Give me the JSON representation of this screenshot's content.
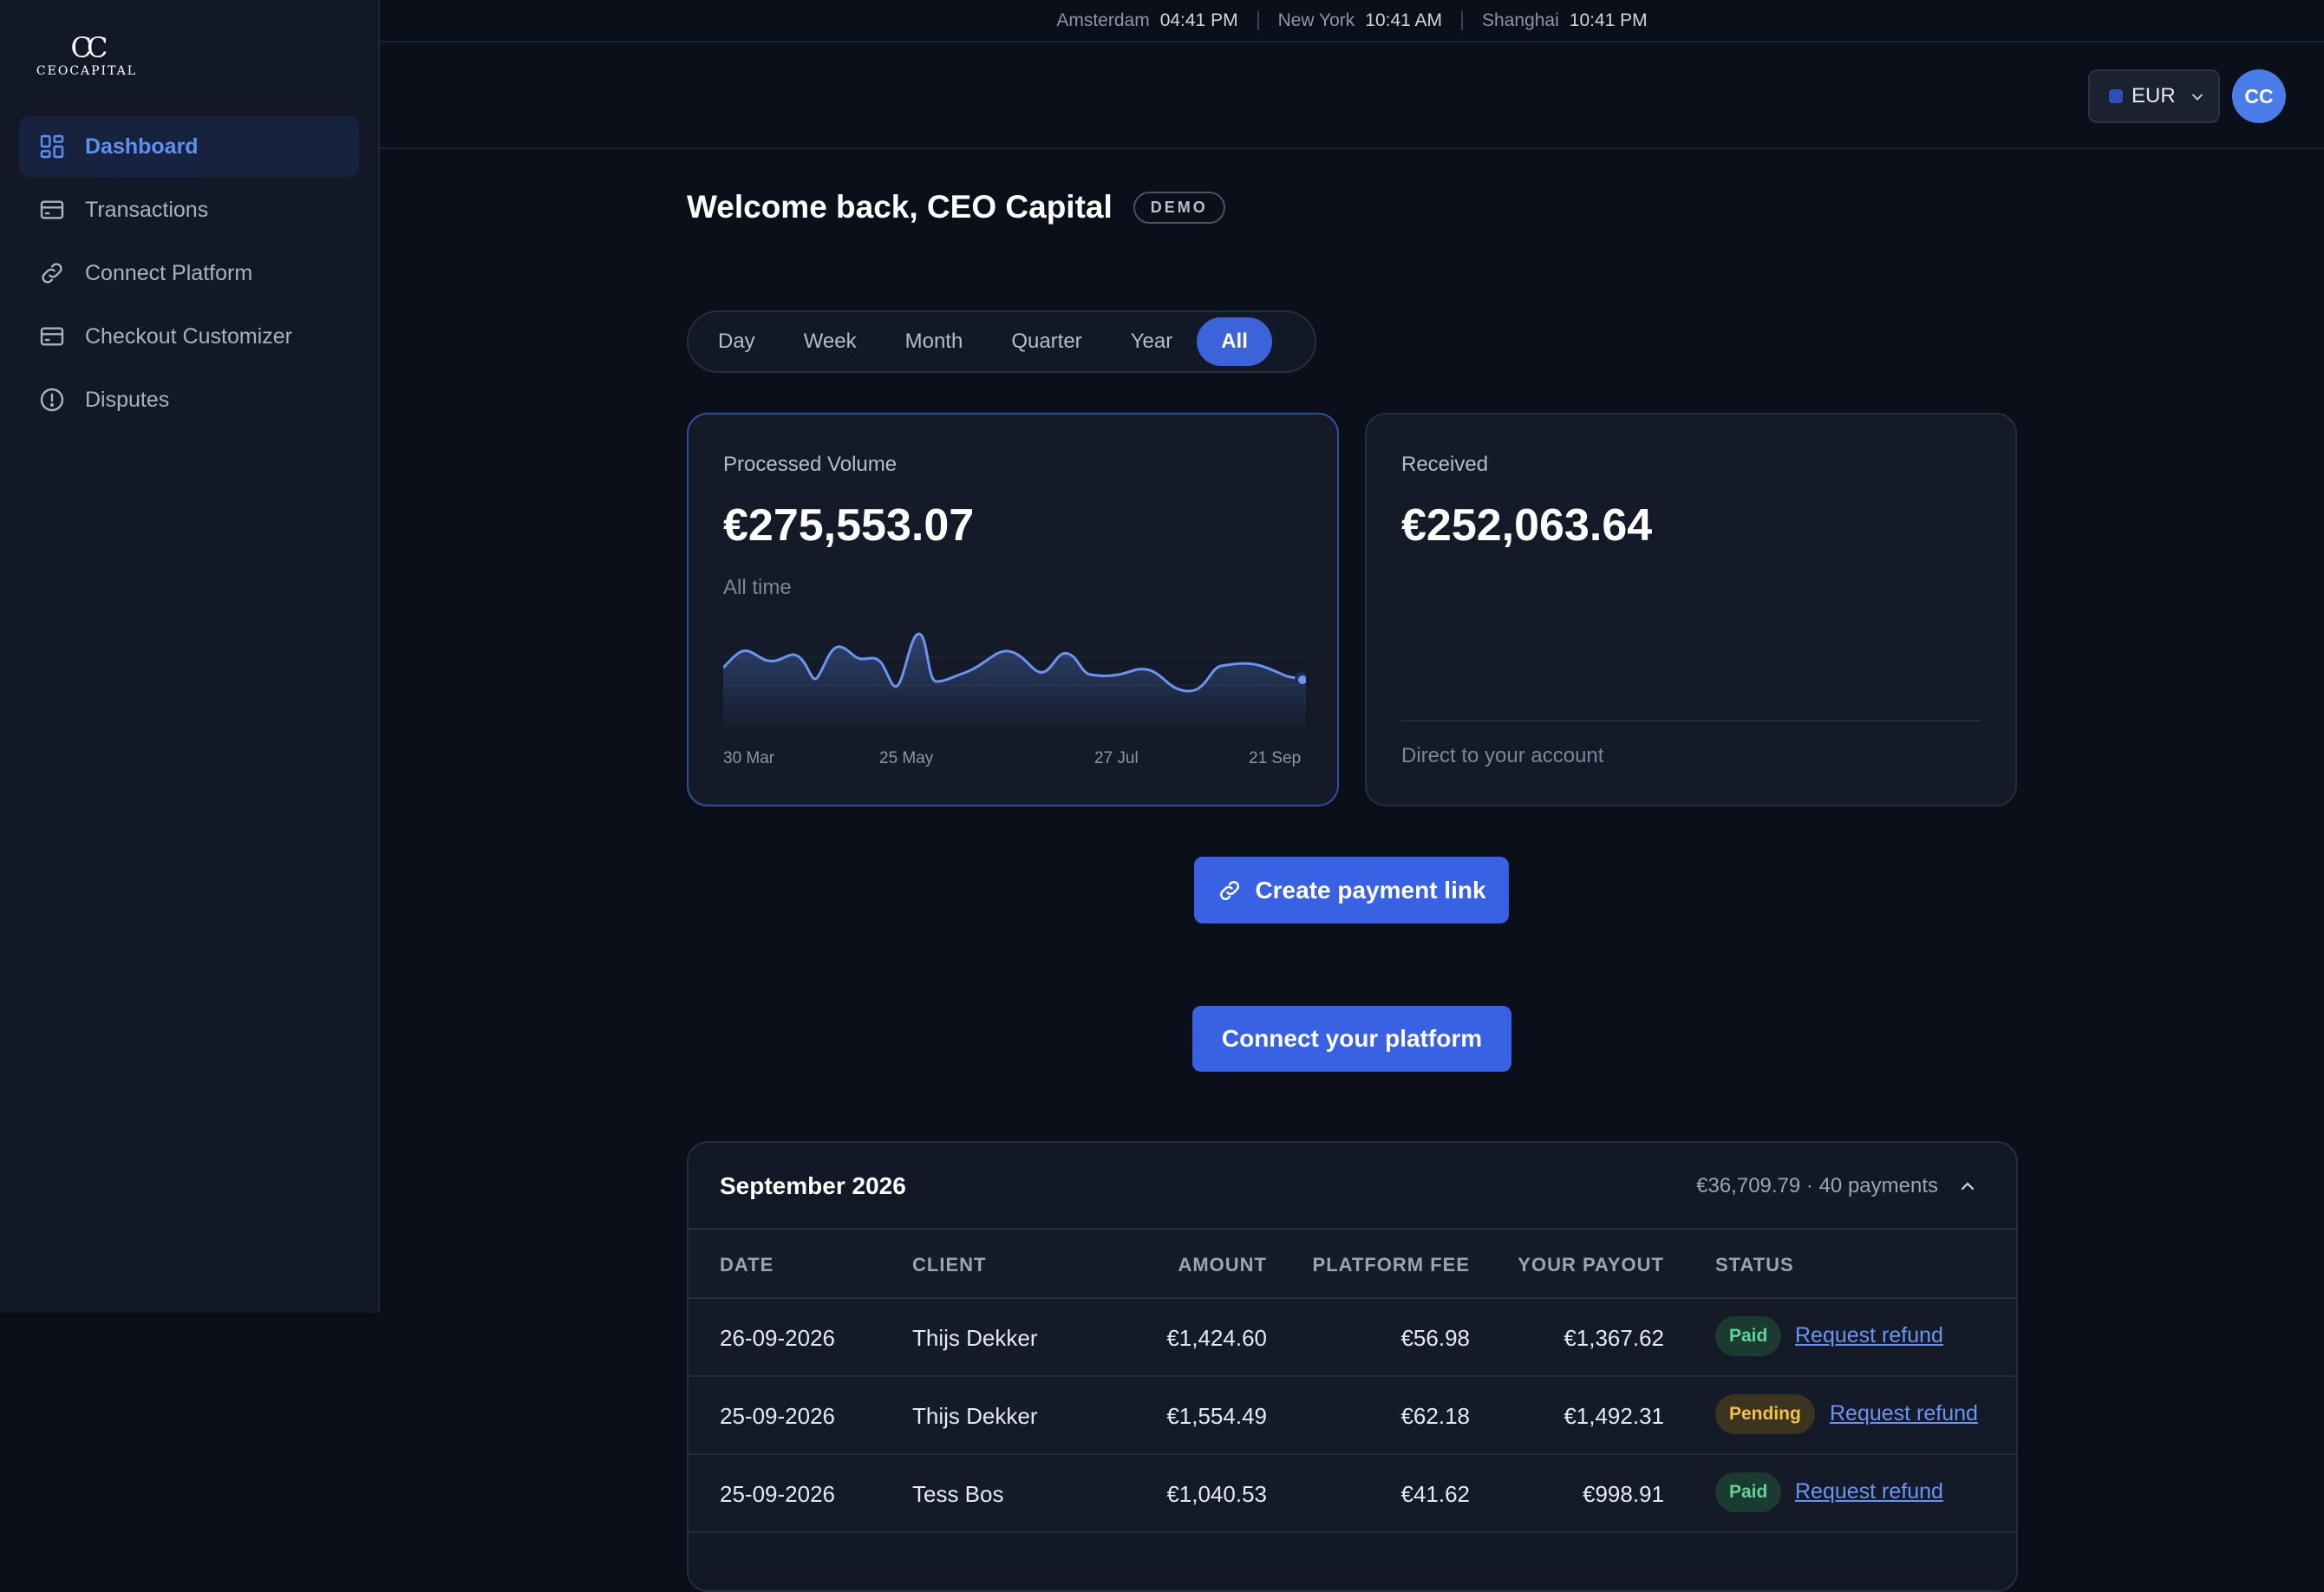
{
  "brand": {
    "mark": "CC",
    "name": "CEOCAPITAL"
  },
  "sidebar": {
    "items": [
      {
        "label": "Dashboard",
        "icon": "dashboard-icon",
        "active": true
      },
      {
        "label": "Transactions",
        "icon": "card-icon"
      },
      {
        "label": "Connect Platform",
        "icon": "link-icon"
      },
      {
        "label": "Checkout Customizer",
        "icon": "card-icon"
      },
      {
        "label": "Disputes",
        "icon": "alert-circle-icon"
      }
    ]
  },
  "clocks": [
    {
      "city": "Amsterdam",
      "time": "04:41 PM"
    },
    {
      "city": "New York",
      "time": "10:41 AM"
    },
    {
      "city": "Shanghai",
      "time": "10:41 PM"
    }
  ],
  "header": {
    "currency": "EUR",
    "avatar_initials": "CC"
  },
  "welcome": {
    "title": "Welcome back, CEO Capital",
    "badge": "DEMO"
  },
  "periods": {
    "options": [
      "Day",
      "Week",
      "Month",
      "Quarter",
      "Year",
      "All"
    ],
    "selected": "All"
  },
  "cards": {
    "processed": {
      "label": "Processed Volume",
      "value": "€275,553.07",
      "sub": "All time",
      "spark_labels": [
        "30 Mar",
        "25 May",
        "27 Jul",
        "21 Sep"
      ]
    },
    "received": {
      "label": "Received",
      "value": "€252,063.64",
      "foot": "Direct to your account"
    }
  },
  "actions": {
    "create_link": "Create payment link",
    "connect_platform": "Connect your platform"
  },
  "month_panel": {
    "title": "September 2026",
    "summary": "€36,709.79 · 40 payments",
    "columns": [
      "DATE",
      "CLIENT",
      "AMOUNT",
      "PLATFORM FEE",
      "YOUR PAYOUT",
      "STATUS"
    ],
    "refund_label": "Request refund",
    "rows": [
      {
        "date": "26-09-2026",
        "client": "Thijs Dekker",
        "amount": "€1,424.60",
        "fee": "€56.98",
        "payout": "€1,367.62",
        "status": "Paid"
      },
      {
        "date": "25-09-2026",
        "client": "Thijs Dekker",
        "amount": "€1,554.49",
        "fee": "€62.18",
        "payout": "€1,492.31",
        "status": "Pending"
      },
      {
        "date": "25-09-2026",
        "client": "Tess Bos",
        "amount": "€1,040.53",
        "fee": "€41.62",
        "payout": "€998.91",
        "status": "Paid"
      }
    ]
  },
  "colors": {
    "accent": "#3961e3",
    "active_nav": "#5d8ff4",
    "paid": "#5fd39a",
    "pending": "#f0c24a",
    "background": "#0b0f19"
  }
}
